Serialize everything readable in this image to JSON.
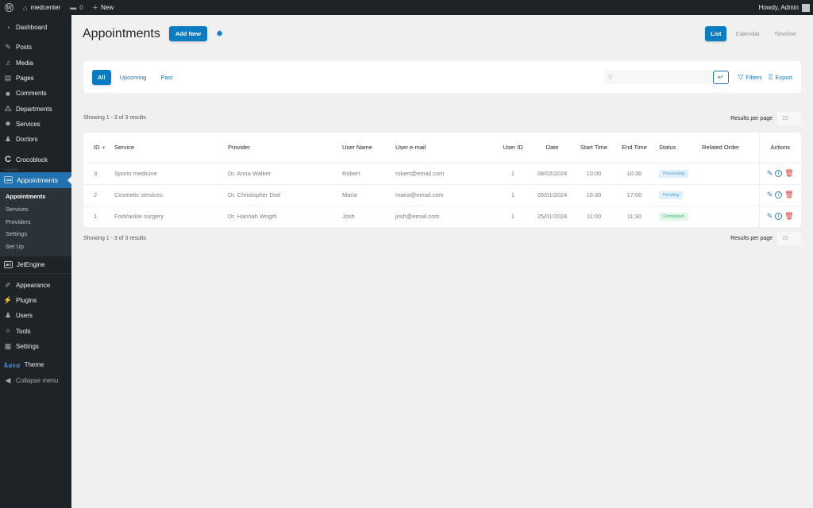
{
  "adminbar": {
    "site_name": "medcenter",
    "comments_count": "0",
    "new_label": "New",
    "greeting": "Howdy, Admin"
  },
  "sidebar": {
    "items_top": [
      {
        "label": "Dashboard",
        "icon": "dashboard-icon"
      },
      {
        "label": "Posts",
        "icon": "pin-icon"
      },
      {
        "label": "Media",
        "icon": "media-icon"
      },
      {
        "label": "Pages",
        "icon": "pages-icon"
      },
      {
        "label": "Comments",
        "icon": "comment-icon"
      },
      {
        "label": "Departments",
        "icon": "departments-icon"
      },
      {
        "label": "Services",
        "icon": "gear-icon"
      },
      {
        "label": "Doctors",
        "icon": "user-icon"
      },
      {
        "label": "Crocoblock",
        "icon": "crocoblock-icon"
      }
    ],
    "plugins_tag": "PLUGINS",
    "active_item": {
      "label": "Appointments",
      "icon": "jet-appointments-icon",
      "icon_text": "JAB"
    },
    "submenu": [
      {
        "label": "Appointments",
        "current": true
      },
      {
        "label": "Services"
      },
      {
        "label": "Providers"
      },
      {
        "label": "Settings"
      },
      {
        "label": "Set Up"
      }
    ],
    "jetengine": {
      "label": "JetEngine",
      "icon_text": "JET"
    },
    "items_bottom": [
      {
        "label": "Appearance",
        "icon": "brush-icon"
      },
      {
        "label": "Plugins",
        "icon": "plugin-icon"
      },
      {
        "label": "Users",
        "icon": "users-icon"
      },
      {
        "label": "Tools",
        "icon": "wrench-icon"
      },
      {
        "label": "Settings",
        "icon": "settings-icon"
      }
    ],
    "theme": {
      "logo_text": "kava",
      "label": "Theme"
    },
    "collapse_label": "Collapse menu"
  },
  "header": {
    "title": "Appointments",
    "add_new_label": "Add New",
    "view_tabs": [
      {
        "label": "List",
        "active": true
      },
      {
        "label": "Calendar"
      },
      {
        "label": "Timeline"
      }
    ]
  },
  "filters": {
    "tabs": [
      {
        "label": "All",
        "active": true
      },
      {
        "label": "Upcoming"
      },
      {
        "label": "Past"
      }
    ],
    "search_value": "",
    "search_placeholder": "",
    "filters_label": "Filters",
    "export_label": "Export"
  },
  "pagination": {
    "showing_text": "Showing 1 - 3 of 3 results",
    "results_per_page_label": "Results per page",
    "results_per_page_value": "15"
  },
  "table": {
    "columns": [
      "ID",
      "Service",
      "Provider",
      "User Name",
      "User e-mail",
      "User ID",
      "Date",
      "Start Time",
      "End Time",
      "Status",
      "Related Order",
      "Actions"
    ],
    "rows": [
      {
        "id": "3",
        "service": "Sports medicine",
        "provider": "Dr. Anna Walker",
        "user_name": "Robert",
        "email": "robert@email.com",
        "user_id": "1",
        "date": "08/02/2024",
        "start": "10:00",
        "end": "10:30",
        "status": "Processing",
        "status_key": "processing",
        "order": ""
      },
      {
        "id": "2",
        "service": "Cosmetic services",
        "provider": "Dr. Christopher Doe",
        "user_name": "Maria",
        "email": "maria@email.com",
        "user_id": "1",
        "date": "05/01/2024",
        "start": "16:30",
        "end": "17:00",
        "status": "Pending",
        "status_key": "pending",
        "order": ""
      },
      {
        "id": "1",
        "service": "Foot/ankle surgery",
        "provider": "Dr. Hannah Wrigth",
        "user_name": "Josh",
        "email": "josh@email.com",
        "user_id": "1",
        "date": "25/01/2024",
        "start": "11:00",
        "end": "11:30",
        "status": "Completed",
        "status_key": "completed",
        "order": ""
      }
    ]
  },
  "colors": {
    "accent": "#0b7cc1",
    "admin_dark": "#1d2327",
    "delete": "#d63638",
    "completed": "#3cb56b",
    "processing": "#4a9cd6"
  }
}
